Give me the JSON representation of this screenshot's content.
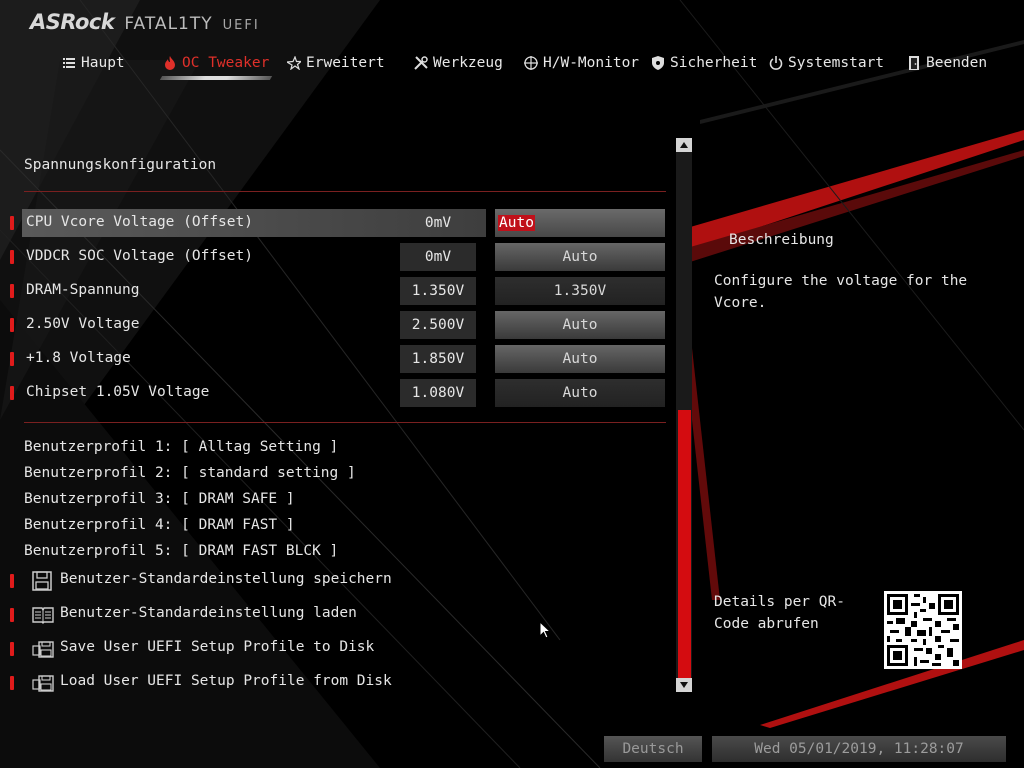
{
  "brand": {
    "vendor": "ASRock",
    "series": "FATAL1TY",
    "product": "UEFI"
  },
  "nav": {
    "tabs": [
      {
        "label": "Haupt",
        "icon": "list-icon",
        "active": false
      },
      {
        "label": "OC Tweaker",
        "icon": "flame-icon",
        "active": true
      },
      {
        "label": "Erweitert",
        "icon": "star-icon",
        "active": false
      },
      {
        "label": "Werkzeug",
        "icon": "tools-icon",
        "active": false
      },
      {
        "label": "H/W-Monitor",
        "icon": "crosshair-icon",
        "active": false
      },
      {
        "label": "Sicherheit",
        "icon": "shield-icon",
        "active": false
      },
      {
        "label": "Systemstart",
        "icon": "power-icon",
        "active": false
      },
      {
        "label": "Beenden",
        "icon": "exit-door-icon",
        "active": false
      }
    ]
  },
  "section": {
    "title": "Spannungskonfiguration"
  },
  "voltages": [
    {
      "label": "CPU Vcore Voltage (Offset)",
      "value": "0mV",
      "setting": "Auto",
      "selected": true
    },
    {
      "label": "VDDCR SOC Voltage (Offset)",
      "value": "0mV",
      "setting": "Auto",
      "selected": false
    },
    {
      "label": "DRAM-Spannung",
      "value": "1.350V",
      "setting": "1.350V",
      "selected": false
    },
    {
      "label": "2.50V Voltage",
      "value": "2.500V",
      "setting": "Auto",
      "selected": false
    },
    {
      "label": "+1.8 Voltage",
      "value": "1.850V",
      "setting": "Auto",
      "selected": false
    },
    {
      "label": "Chipset 1.05V Voltage",
      "value": "1.080V",
      "setting": "Auto",
      "selected": false
    }
  ],
  "profiles": [
    "Benutzerprofil 1: [ Alltag Setting ]",
    "Benutzerprofil 2: [ standard setting ]",
    "Benutzerprofil 3: [ DRAM SAFE ]",
    "Benutzerprofil 4: [ DRAM FAST ]",
    "Benutzerprofil 5: [ DRAM FAST BLCK ]"
  ],
  "actions": [
    {
      "label": "Benutzer-Standardeinstellung speichern",
      "icon": "floppy-disk-icon"
    },
    {
      "label": "Benutzer-Standardeinstellung laden",
      "icon": "book-icon"
    },
    {
      "label": "Save User UEFI Setup Profile to Disk",
      "icon": "save-to-disk-icon"
    },
    {
      "label": "Load User UEFI Setup Profile from Disk",
      "icon": "load-from-disk-icon"
    }
  ],
  "description": {
    "title": "Beschreibung",
    "text": "Configure the voltage for the Vcore.",
    "qr_label": "Details per QR-Code abrufen"
  },
  "footer": {
    "language": "Deutsch",
    "datetime": "Wed 05/01/2019, 11:28:07"
  },
  "colors": {
    "accent": "#d40c10",
    "background": "#000000",
    "text": "#e6e6e6"
  }
}
